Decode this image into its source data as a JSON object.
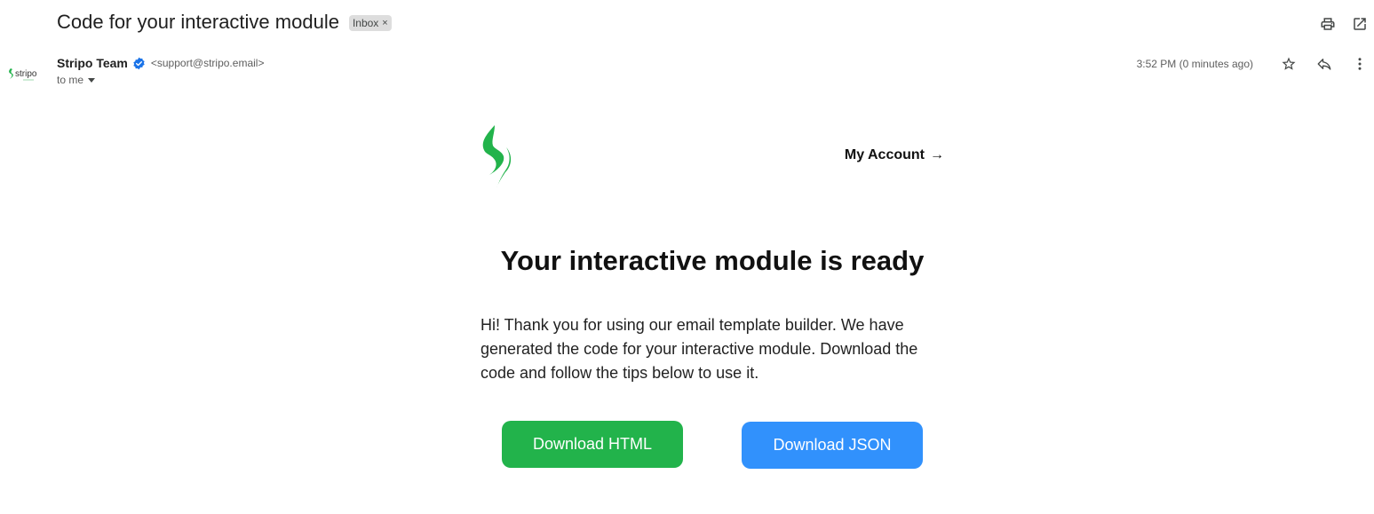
{
  "header": {
    "subject": "Code for your interactive module",
    "label": "Inbox",
    "label_remove": "×",
    "print_icon": "print-icon",
    "open_new_window_icon": "open-in-new-window-icon"
  },
  "sender": {
    "avatar_text": "stripo",
    "name": "Stripo Team",
    "email": "<support@stripo.email>",
    "to": "to me",
    "timestamp": "3:52 PM (0 minutes ago)",
    "star_icon": "star-icon",
    "reply_icon": "reply-icon",
    "more_icon": "more-vertical-icon"
  },
  "email": {
    "my_account": "My Account",
    "my_account_arrow": "→",
    "headline": "Your interactive module is ready",
    "body": "Hi! Thank you for using our email template builder. We have generated the code for your interactive module. Download the code and follow the tips below to use it.",
    "buttons": {
      "html": "Download HTML",
      "json": "Download JSON"
    }
  },
  "colors": {
    "brand_green": "#22b34b",
    "json_blue": "#3191fc",
    "verified_blue": "#1a73e8"
  }
}
